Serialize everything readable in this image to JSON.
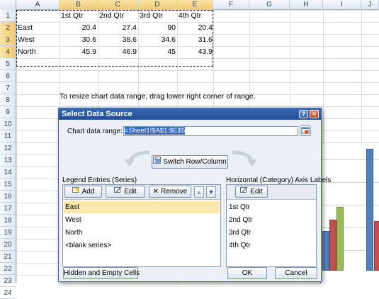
{
  "columns": [
    "A",
    "B",
    "C",
    "D",
    "E",
    "F",
    "G",
    "H",
    "I",
    "J"
  ],
  "rows": [
    "1",
    "2",
    "3",
    "4",
    "5",
    "6",
    "7",
    "8",
    "9",
    "10",
    "11",
    "12",
    "13",
    "14",
    "15",
    "16",
    "17",
    "18",
    "19",
    "20",
    "21",
    "22",
    "23",
    "24"
  ],
  "table": {
    "headers": [
      "1st Qtr",
      "2nd Qtr",
      "3rd Qtr",
      "4th Qtr"
    ],
    "data": [
      {
        "label": "East",
        "values": [
          "20.4",
          "27.4",
          "90",
          "20.4"
        ]
      },
      {
        "label": "West",
        "values": [
          "30.6",
          "38.6",
          "34.6",
          "31.6"
        ]
      },
      {
        "label": "North",
        "values": [
          "45.9",
          "46.9",
          "45",
          "43.9"
        ]
      }
    ]
  },
  "note": "To resize chart data range, drag lower right corner of range.",
  "dialog": {
    "title": "Select Data Source",
    "help_glyph": "?",
    "close_glyph": "✕",
    "range_label": "Chart data range:",
    "range_value": "=Sheet1!$A$1:$E$5",
    "switch_label": "Switch Row/Column",
    "legend_label": "Legend Entries (Series)",
    "axis_label": "Horizontal (Category) Axis Labels",
    "add_label": "Add",
    "edit_label": "Edit",
    "remove_label": "Remove",
    "axis_edit_label": "Edit",
    "series": [
      "East",
      "West",
      "North",
      "<blank series>"
    ],
    "categories": [
      "1st Qtr",
      "2nd Qtr",
      "3rd Qtr",
      "4th Qtr"
    ],
    "hidden_label": "Hidden and Empty Cells",
    "ok_label": "OK",
    "cancel_label": "Cancel"
  },
  "colors": {
    "series_east": "#4f81bd",
    "series_west": "#c0504d",
    "series_north": "#9bbb59",
    "titlebar": "#1f4e95",
    "selection": "#fbe6b0"
  }
}
